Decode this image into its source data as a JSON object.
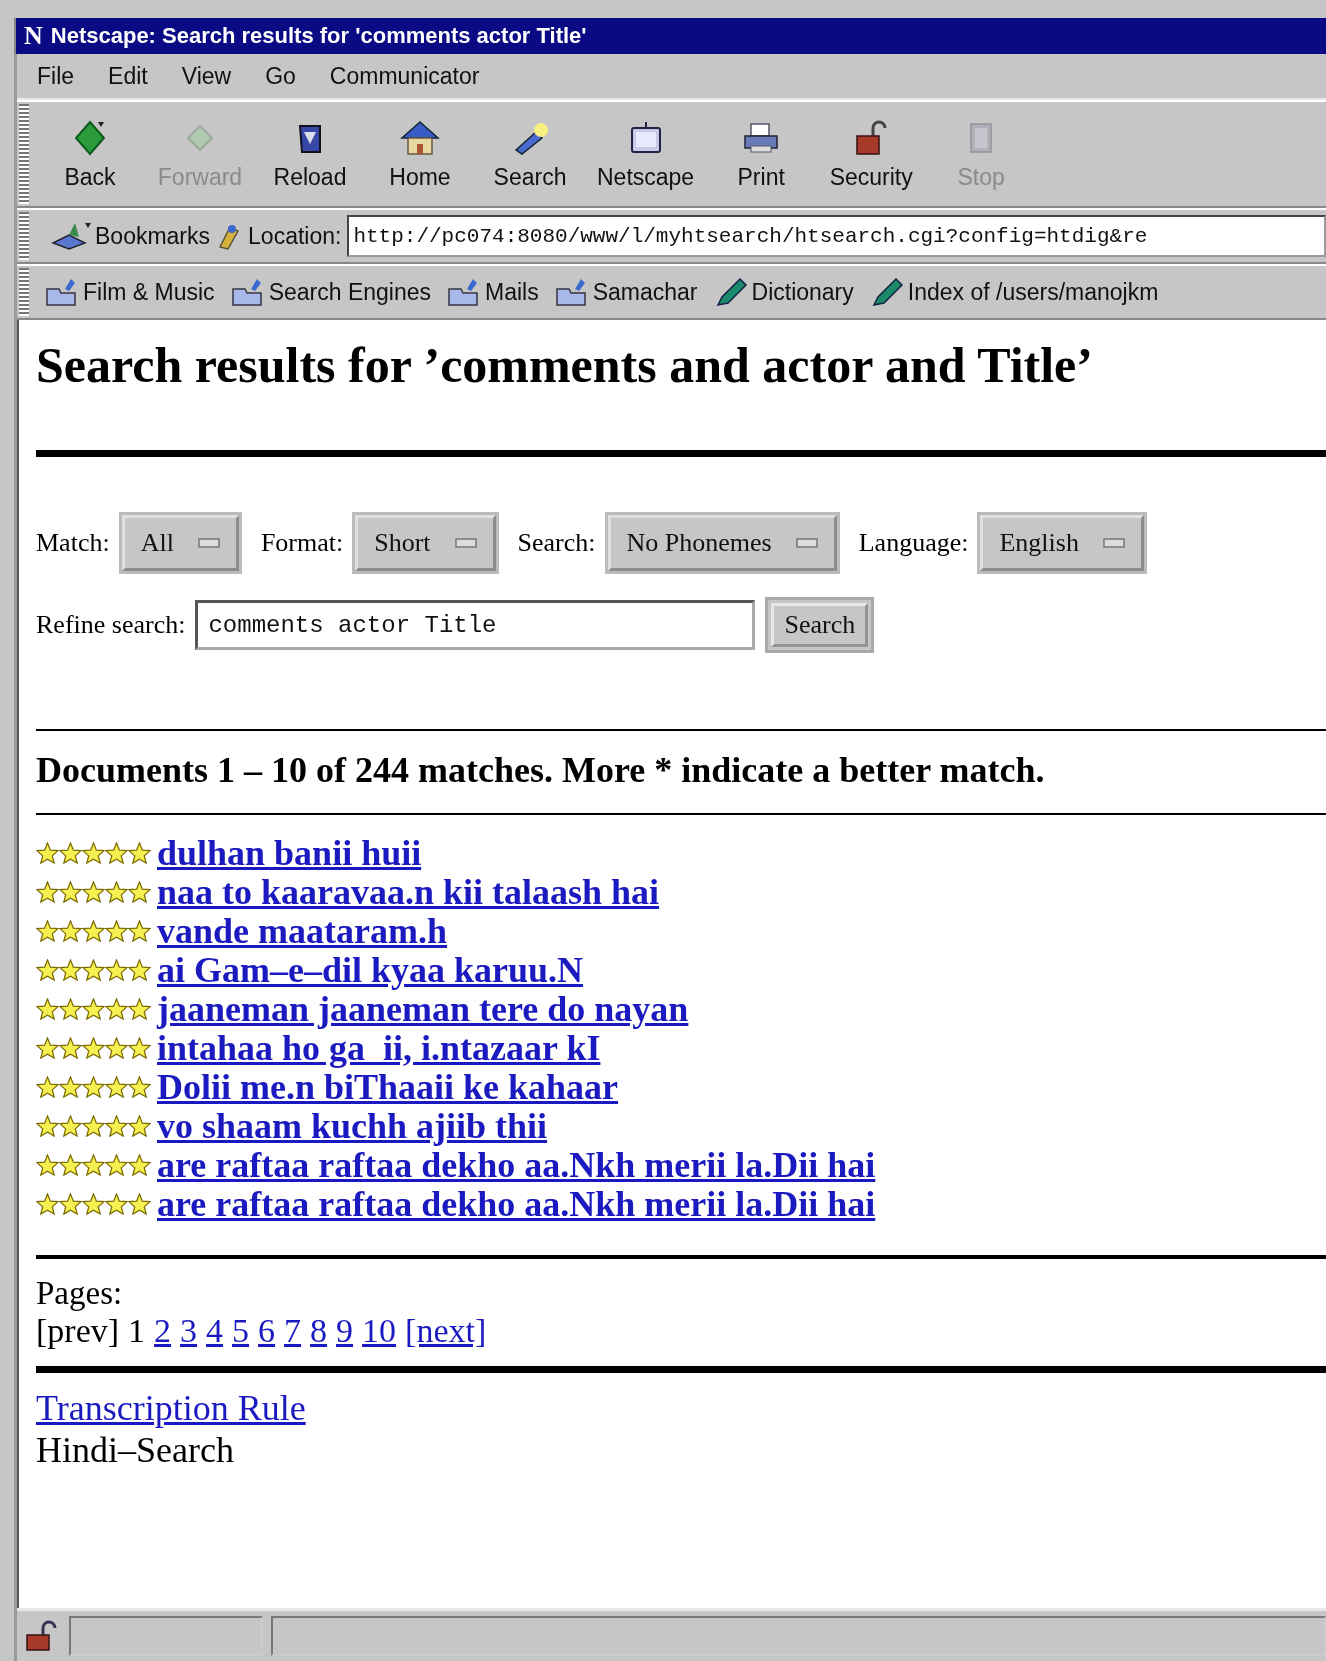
{
  "window": {
    "logo": "N",
    "title": "Netscape: Search results for 'comments actor Title'"
  },
  "menu": [
    "File",
    "Edit",
    "View",
    "Go",
    "Communicator"
  ],
  "toolbar": [
    {
      "label": "Back",
      "disabled": false
    },
    {
      "label": "Forward",
      "disabled": true
    },
    {
      "label": "Reload",
      "disabled": false
    },
    {
      "label": "Home",
      "disabled": false
    },
    {
      "label": "Search",
      "disabled": false
    },
    {
      "label": "Netscape",
      "disabled": false
    },
    {
      "label": "Print",
      "disabled": false
    },
    {
      "label": "Security",
      "disabled": false
    },
    {
      "label": "Stop",
      "disabled": true
    }
  ],
  "location_bar": {
    "bookmarks": "Bookmarks",
    "label": "Location:",
    "url": "http://pc074:8080/www/l/myhtsearch/htsearch.cgi?config=htdig&re"
  },
  "personal_toolbar": [
    {
      "label": "Film & Music",
      "kind": "folder"
    },
    {
      "label": "Search Engines",
      "kind": "folder"
    },
    {
      "label": "Mails",
      "kind": "folder"
    },
    {
      "label": "Samachar",
      "kind": "folder"
    },
    {
      "label": "Dictionary",
      "kind": "bookmark"
    },
    {
      "label": "Index of /users/manojkm",
      "kind": "bookmark"
    }
  ],
  "page": {
    "heading": "Search results for ’comments and actor and Title’",
    "options": [
      {
        "label": "Match:",
        "value": "All"
      },
      {
        "label": "Format:",
        "value": "Short"
      },
      {
        "label": "Search:",
        "value": "No Phonemes"
      },
      {
        "label": "Language:",
        "value": "English"
      }
    ],
    "refine": {
      "label": "Refine search:",
      "value": "comments actor Title",
      "button": "Search"
    },
    "summary": "Documents 1 – 10 of 244 matches. More * indicate a better match.",
    "results": [
      {
        "title": "dulhan banii huii",
        "stars": 5
      },
      {
        "title": "naa to kaaravaa.n kii talaash hai",
        "stars": 5
      },
      {
        "title": "vande maataram.h",
        "stars": 5
      },
      {
        "title": "ai Gam–e–dil kyaa karuu.N",
        "stars": 5
      },
      {
        "title": "jaaneman jaaneman tere do nayan",
        "stars": 5
      },
      {
        "title": "intahaa ho ga_ii, i.ntazaar kI",
        "stars": 5
      },
      {
        "title": "Dolii me.n biThaaii ke kahaar",
        "stars": 5
      },
      {
        "title": "vo shaam kuchh ajiib thii",
        "stars": 5
      },
      {
        "title": "are raftaa raftaa dekho aa.Nkh merii la.Dii hai",
        "stars": 5
      },
      {
        "title": "are raftaa raftaa dekho aa.Nkh merii la.Dii hai",
        "stars": 5
      }
    ],
    "pages_label": "Pages:",
    "prev": "[prev]",
    "pages": [
      {
        "label": "1",
        "selected": true
      },
      {
        "label": "2",
        "selected": false
      },
      {
        "label": "3",
        "selected": false
      },
      {
        "label": "4",
        "selected": false
      },
      {
        "label": "5",
        "selected": false
      },
      {
        "label": "6",
        "selected": false
      },
      {
        "label": "7",
        "selected": false
      },
      {
        "label": "8",
        "selected": false
      },
      {
        "label": "9",
        "selected": false
      },
      {
        "label": "10",
        "selected": false
      }
    ],
    "next": "[next]",
    "footer_link": "Transcription Rule",
    "footer_text": "Hindi–Search"
  }
}
